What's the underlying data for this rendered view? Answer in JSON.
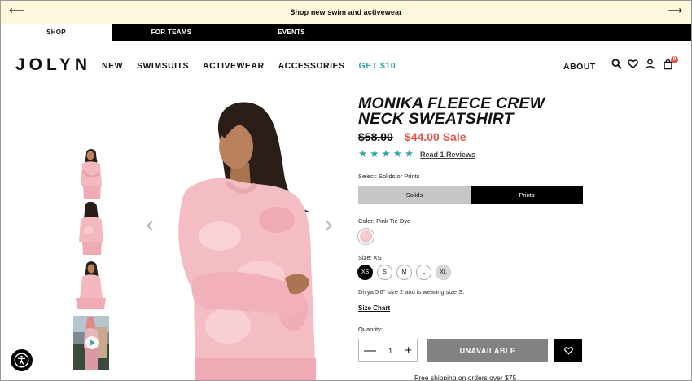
{
  "promo": {
    "text": "Shop new swim and activewear",
    "prev_icon": "arrow-left-icon",
    "next_icon": "arrow-right-icon"
  },
  "tabs": [
    {
      "label": "SHOP",
      "active": true
    },
    {
      "label": "FOR TEAMS",
      "active": false
    },
    {
      "label": "EVENTS",
      "active": false
    }
  ],
  "header": {
    "logo": "JOLYN",
    "nav": [
      "NEW",
      "SWIMSUITS",
      "ACTIVEWEAR",
      "ACCESSORIES",
      "GET $10"
    ],
    "about": "ABOUT",
    "cart_count": "0",
    "accent_color": "#2fa3a7"
  },
  "gallery": {
    "thumbnails": [
      "front view",
      "back view",
      "seated view",
      "video lifestyle"
    ]
  },
  "product": {
    "title": "MONIKA FLEECE CREW NECK SWEATSHIRT",
    "price_original": "$58.00",
    "price_sale": "$44.00 Sale",
    "rating": 5,
    "reviews_link": "Read 1 Reviews",
    "select_label": "Select: Solids or Prints",
    "options": [
      "Solids",
      "Prints"
    ],
    "selected_option": "Prints",
    "color_label": "Color: Pink Tie Dye",
    "size_label": "Size: XS",
    "sizes": [
      "XS",
      "S",
      "M",
      "L",
      "XL"
    ],
    "selected_size": "XS",
    "model_note": "Divya 5'6'' size 2 and is wearing size S.",
    "size_chart": "Size Chart",
    "quantity_label": "Quantity:",
    "quantity": "1",
    "cta": "UNAVAILABLE",
    "shipping_note": "Free shipping on orders over $75",
    "sale_color": "#e2574c"
  }
}
